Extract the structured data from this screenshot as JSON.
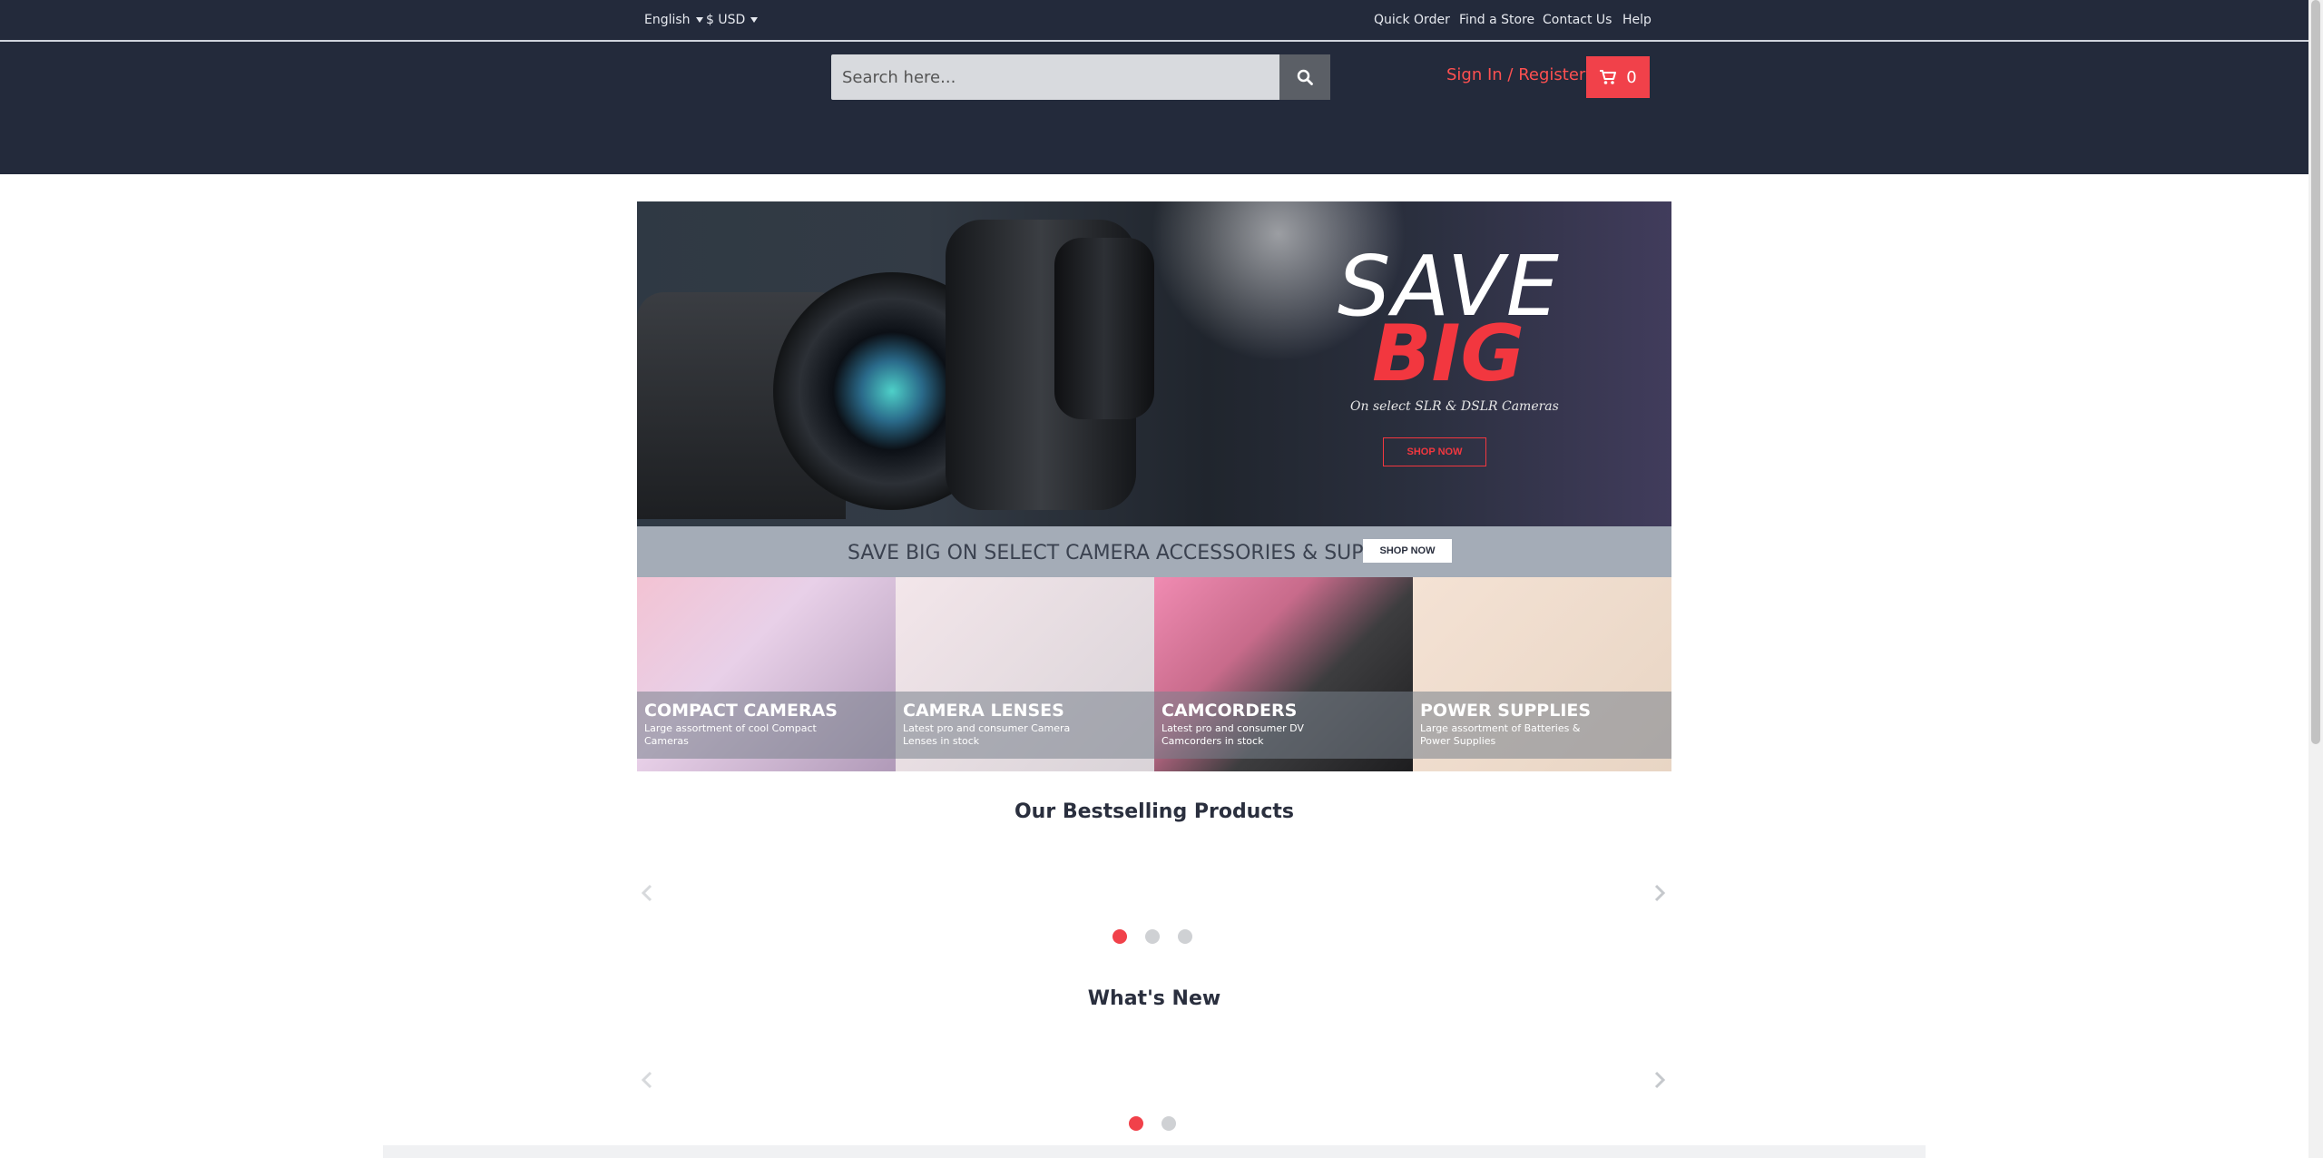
{
  "topbar": {
    "language": "English",
    "currency": "$ USD",
    "links": [
      "Quick Order",
      "Find a Store",
      "Contact Us",
      "Help"
    ]
  },
  "header": {
    "search_placeholder": "Search here...",
    "signin_label": "Sign In / Register",
    "cart_count": "0"
  },
  "hero": {
    "headline_1": "SAVE",
    "headline_2": "BIG",
    "subtitle": "On select SLR & DSLR Cameras",
    "cta": "SHOP NOW"
  },
  "promo": {
    "text": "SAVE BIG ON SELECT CAMERA ACCESSORIES & SUPPLIES",
    "cta": "SHOP NOW"
  },
  "categories": [
    {
      "name": "COMPACT CAMERAS",
      "desc": "Large assortment of cool Compact Cameras"
    },
    {
      "name": "CAMERA LENSES",
      "desc": "Latest pro and consumer Camera Lenses in stock"
    },
    {
      "name": "CAMCORDERS",
      "desc": "Latest pro and consumer DV Camcorders in stock"
    },
    {
      "name": "POWER SUPPLIES",
      "desc": "Large assortment of Batteries & Power Supplies"
    }
  ],
  "sections": {
    "bestselling": {
      "title": "Our Bestselling Products",
      "pages": 3,
      "active_page": 1
    },
    "whats_new": {
      "title": "What's New",
      "pages": 2,
      "active_page": 1
    }
  },
  "colors": {
    "header_bg": "#232a3b",
    "accent": "#f1414a",
    "signin": "#ff5050"
  },
  "icons": {
    "search": "search-icon",
    "cart": "cart-icon",
    "prev": "chevron-left-icon",
    "next": "chevron-right-icon"
  }
}
